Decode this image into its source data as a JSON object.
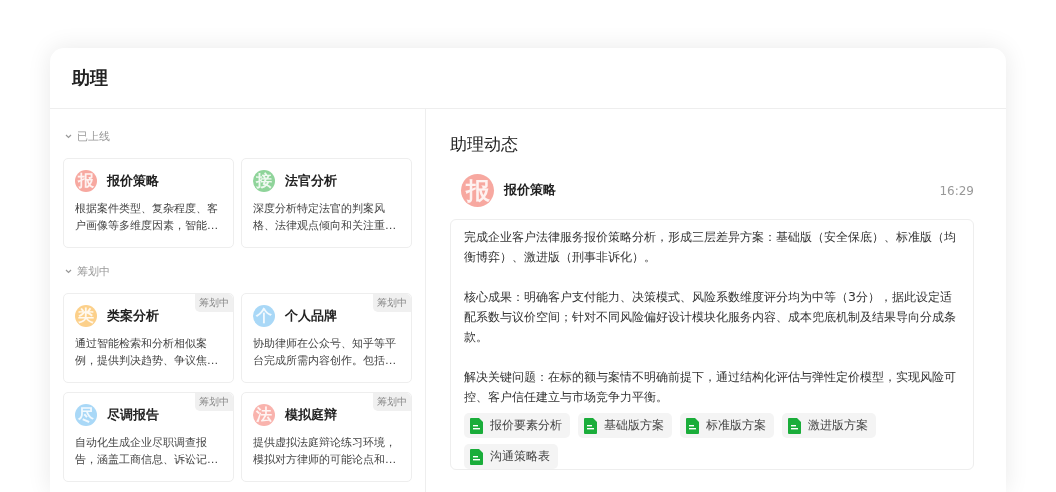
{
  "window": {
    "title": "助理"
  },
  "sections": [
    {
      "title": "已上线",
      "expanded": true,
      "cards": [
        {
          "avatar": "报",
          "color": "#f7a8a0",
          "name": "报价策略",
          "description": "根据案件类型、复杂程度、客户画像等多维度因素，智能…"
        },
        {
          "avatar": "接",
          "color": "#8fd49a",
          "name": "法官分析",
          "description": "深度分析特定法官的判案风格、法律观点倾向和关注重…"
        }
      ]
    },
    {
      "title": "筹划中",
      "expanded": true,
      "cards": [
        {
          "avatar": "类",
          "color": "#fcd08a",
          "name": "类案分析",
          "badge": "筹划中",
          "description": "通过智能检索和分析相似案例，提供判决趋势、争议焦…"
        },
        {
          "avatar": "个",
          "color": "#a9d8f7",
          "name": "个人品牌",
          "badge": "筹划中",
          "description": "协助律师在公众号、知乎等平台完成所需内容创作。包括…"
        },
        {
          "avatar": "尽",
          "color": "#a9d8f7",
          "name": "尽调报告",
          "badge": "筹划中",
          "description": "自动化生成企业尽职调查报告，涵盖工商信息、诉讼记…"
        },
        {
          "avatar": "法",
          "color": "#f9b3ad",
          "name": "模拟庭辩",
          "badge": "筹划中",
          "description": "提供虚拟法庭辩论练习环境，模拟对方律师的可能论点和…"
        }
      ]
    }
  ],
  "feed": {
    "title": "助理动态",
    "messages": [
      {
        "avatar": "报",
        "color": "#f7a8a0",
        "name": "报价策略",
        "time": "16:29",
        "paragraphs": [
          "完成企业客户法律服务报价策略分析，形成三层差异方案：基础版（安全保底）、标准版（均衡博弈）、激进版（刑事非诉化）。",
          "核心成果：明确客户支付能力、决策模式、风险系数维度评分均为中等（3分），据此设定适配系数与议价空间；针对不同风险偏好设计模块化服务内容、成本兜底机制及结果导向分成条款。",
          "解决关键问题：在标的额与案情不明确前提下，通过结构化评估与弹性定价模型，实现风险可控、客户信任建立与市场竞争力平衡。"
        ],
        "attachments": [
          "报价要素分析",
          "基础版方案",
          "标准版方案",
          "激进版方案",
          "沟通策略表"
        ]
      }
    ]
  }
}
